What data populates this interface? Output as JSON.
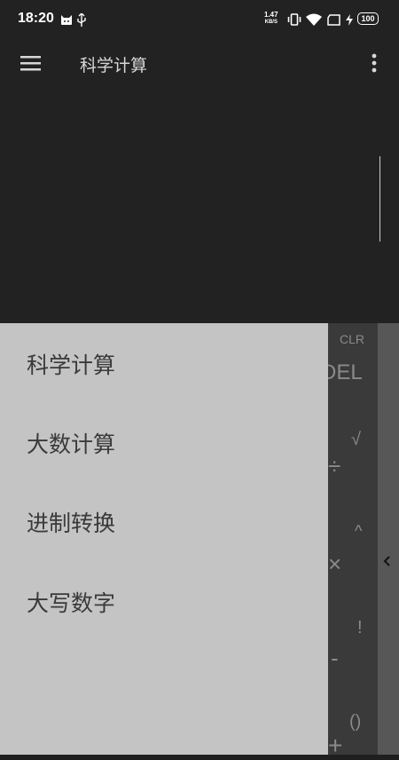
{
  "status_bar": {
    "time": "18:20",
    "net_speed_value": "1.47",
    "net_speed_unit": "KB/S",
    "battery": "100",
    "icons": [
      "cat-notification-icon",
      "usb-icon",
      "vibrate-icon",
      "wifi-icon",
      "sim-icon",
      "charging-icon",
      "battery-icon"
    ]
  },
  "app_bar": {
    "title": "科学计算",
    "menu_icon": "hamburger-menu-icon",
    "overflow_icon": "more-vert-icon"
  },
  "drawer": {
    "items": [
      {
        "label": "科学计算"
      },
      {
        "label": "大数计算"
      },
      {
        "label": "进制转换"
      },
      {
        "label": "大写数字"
      }
    ]
  },
  "keypad_partial": {
    "clr": "CLR",
    "del": "DEL",
    "sqrt": "√",
    "divide": "÷",
    "power": "^",
    "multiply": "×",
    "factorial": "!",
    "minus": "-",
    "parens": "()",
    "plus": "+"
  },
  "colors": {
    "topbar": "#222222",
    "drawer_bg": "#c4c4c4",
    "drawer_text": "#3a3a3a",
    "keypad_bg": "#3a3a3a",
    "keypad_side": "#575757"
  }
}
